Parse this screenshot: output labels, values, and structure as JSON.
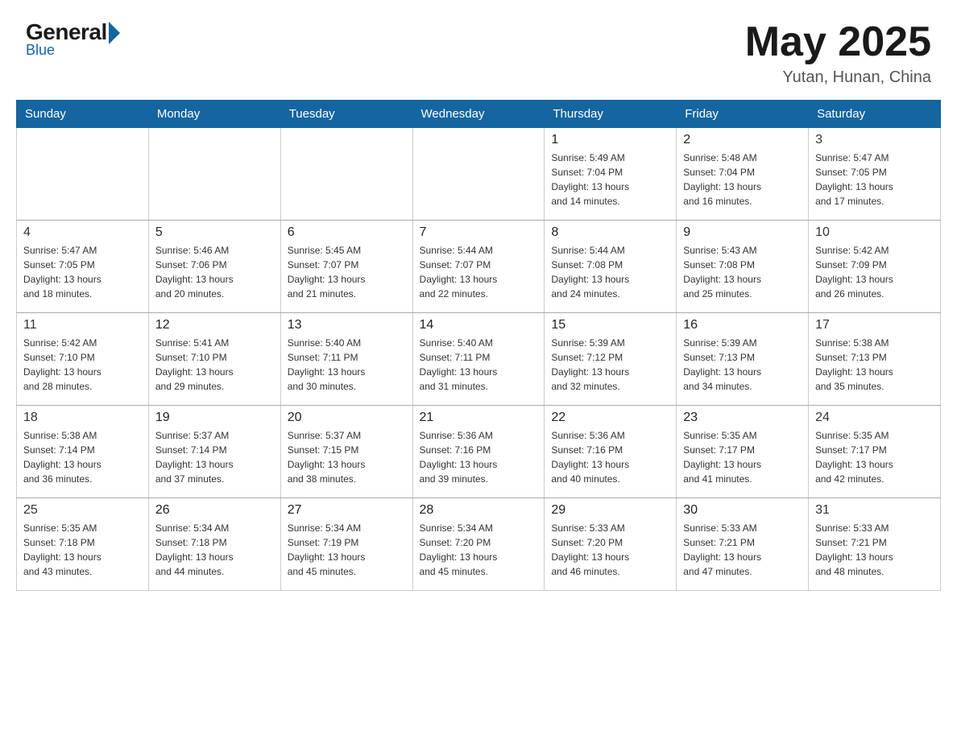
{
  "header": {
    "logo": {
      "general": "General",
      "blue": "Blue"
    },
    "month": "May 2025",
    "location": "Yutan, Hunan, China"
  },
  "days_of_week": [
    "Sunday",
    "Monday",
    "Tuesday",
    "Wednesday",
    "Thursday",
    "Friday",
    "Saturday"
  ],
  "weeks": [
    [
      {
        "day": "",
        "info": ""
      },
      {
        "day": "",
        "info": ""
      },
      {
        "day": "",
        "info": ""
      },
      {
        "day": "",
        "info": ""
      },
      {
        "day": "1",
        "info": "Sunrise: 5:49 AM\nSunset: 7:04 PM\nDaylight: 13 hours\nand 14 minutes."
      },
      {
        "day": "2",
        "info": "Sunrise: 5:48 AM\nSunset: 7:04 PM\nDaylight: 13 hours\nand 16 minutes."
      },
      {
        "day": "3",
        "info": "Sunrise: 5:47 AM\nSunset: 7:05 PM\nDaylight: 13 hours\nand 17 minutes."
      }
    ],
    [
      {
        "day": "4",
        "info": "Sunrise: 5:47 AM\nSunset: 7:05 PM\nDaylight: 13 hours\nand 18 minutes."
      },
      {
        "day": "5",
        "info": "Sunrise: 5:46 AM\nSunset: 7:06 PM\nDaylight: 13 hours\nand 20 minutes."
      },
      {
        "day": "6",
        "info": "Sunrise: 5:45 AM\nSunset: 7:07 PM\nDaylight: 13 hours\nand 21 minutes."
      },
      {
        "day": "7",
        "info": "Sunrise: 5:44 AM\nSunset: 7:07 PM\nDaylight: 13 hours\nand 22 minutes."
      },
      {
        "day": "8",
        "info": "Sunrise: 5:44 AM\nSunset: 7:08 PM\nDaylight: 13 hours\nand 24 minutes."
      },
      {
        "day": "9",
        "info": "Sunrise: 5:43 AM\nSunset: 7:08 PM\nDaylight: 13 hours\nand 25 minutes."
      },
      {
        "day": "10",
        "info": "Sunrise: 5:42 AM\nSunset: 7:09 PM\nDaylight: 13 hours\nand 26 minutes."
      }
    ],
    [
      {
        "day": "11",
        "info": "Sunrise: 5:42 AM\nSunset: 7:10 PM\nDaylight: 13 hours\nand 28 minutes."
      },
      {
        "day": "12",
        "info": "Sunrise: 5:41 AM\nSunset: 7:10 PM\nDaylight: 13 hours\nand 29 minutes."
      },
      {
        "day": "13",
        "info": "Sunrise: 5:40 AM\nSunset: 7:11 PM\nDaylight: 13 hours\nand 30 minutes."
      },
      {
        "day": "14",
        "info": "Sunrise: 5:40 AM\nSunset: 7:11 PM\nDaylight: 13 hours\nand 31 minutes."
      },
      {
        "day": "15",
        "info": "Sunrise: 5:39 AM\nSunset: 7:12 PM\nDaylight: 13 hours\nand 32 minutes."
      },
      {
        "day": "16",
        "info": "Sunrise: 5:39 AM\nSunset: 7:13 PM\nDaylight: 13 hours\nand 34 minutes."
      },
      {
        "day": "17",
        "info": "Sunrise: 5:38 AM\nSunset: 7:13 PM\nDaylight: 13 hours\nand 35 minutes."
      }
    ],
    [
      {
        "day": "18",
        "info": "Sunrise: 5:38 AM\nSunset: 7:14 PM\nDaylight: 13 hours\nand 36 minutes."
      },
      {
        "day": "19",
        "info": "Sunrise: 5:37 AM\nSunset: 7:14 PM\nDaylight: 13 hours\nand 37 minutes."
      },
      {
        "day": "20",
        "info": "Sunrise: 5:37 AM\nSunset: 7:15 PM\nDaylight: 13 hours\nand 38 minutes."
      },
      {
        "day": "21",
        "info": "Sunrise: 5:36 AM\nSunset: 7:16 PM\nDaylight: 13 hours\nand 39 minutes."
      },
      {
        "day": "22",
        "info": "Sunrise: 5:36 AM\nSunset: 7:16 PM\nDaylight: 13 hours\nand 40 minutes."
      },
      {
        "day": "23",
        "info": "Sunrise: 5:35 AM\nSunset: 7:17 PM\nDaylight: 13 hours\nand 41 minutes."
      },
      {
        "day": "24",
        "info": "Sunrise: 5:35 AM\nSunset: 7:17 PM\nDaylight: 13 hours\nand 42 minutes."
      }
    ],
    [
      {
        "day": "25",
        "info": "Sunrise: 5:35 AM\nSunset: 7:18 PM\nDaylight: 13 hours\nand 43 minutes."
      },
      {
        "day": "26",
        "info": "Sunrise: 5:34 AM\nSunset: 7:18 PM\nDaylight: 13 hours\nand 44 minutes."
      },
      {
        "day": "27",
        "info": "Sunrise: 5:34 AM\nSunset: 7:19 PM\nDaylight: 13 hours\nand 45 minutes."
      },
      {
        "day": "28",
        "info": "Sunrise: 5:34 AM\nSunset: 7:20 PM\nDaylight: 13 hours\nand 45 minutes."
      },
      {
        "day": "29",
        "info": "Sunrise: 5:33 AM\nSunset: 7:20 PM\nDaylight: 13 hours\nand 46 minutes."
      },
      {
        "day": "30",
        "info": "Sunrise: 5:33 AM\nSunset: 7:21 PM\nDaylight: 13 hours\nand 47 minutes."
      },
      {
        "day": "31",
        "info": "Sunrise: 5:33 AM\nSunset: 7:21 PM\nDaylight: 13 hours\nand 48 minutes."
      }
    ]
  ]
}
